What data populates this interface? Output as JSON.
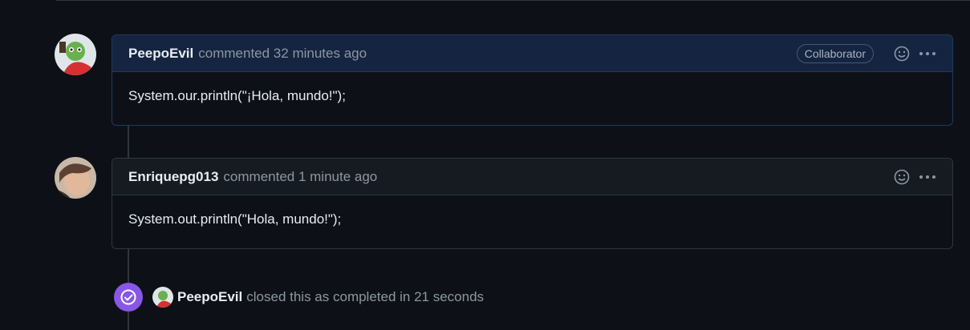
{
  "comments": [
    {
      "author": "PeepoEvil",
      "meta": "commented 32 minutes ago",
      "badge": "Collaborator",
      "body": "System.our.println(\"¡Hola, mundo!\");"
    },
    {
      "author": "Enriquepg013",
      "meta": "commented 1 minute ago",
      "body": "System.out.println(\"Hola, mundo!\");"
    }
  ],
  "event": {
    "author": "PeepoEvil",
    "text": "closed this as completed in 21 seconds"
  },
  "colors": {
    "background": "#0d1117",
    "collaborator_header": "#152440",
    "closed_badge": "#8957e5"
  }
}
